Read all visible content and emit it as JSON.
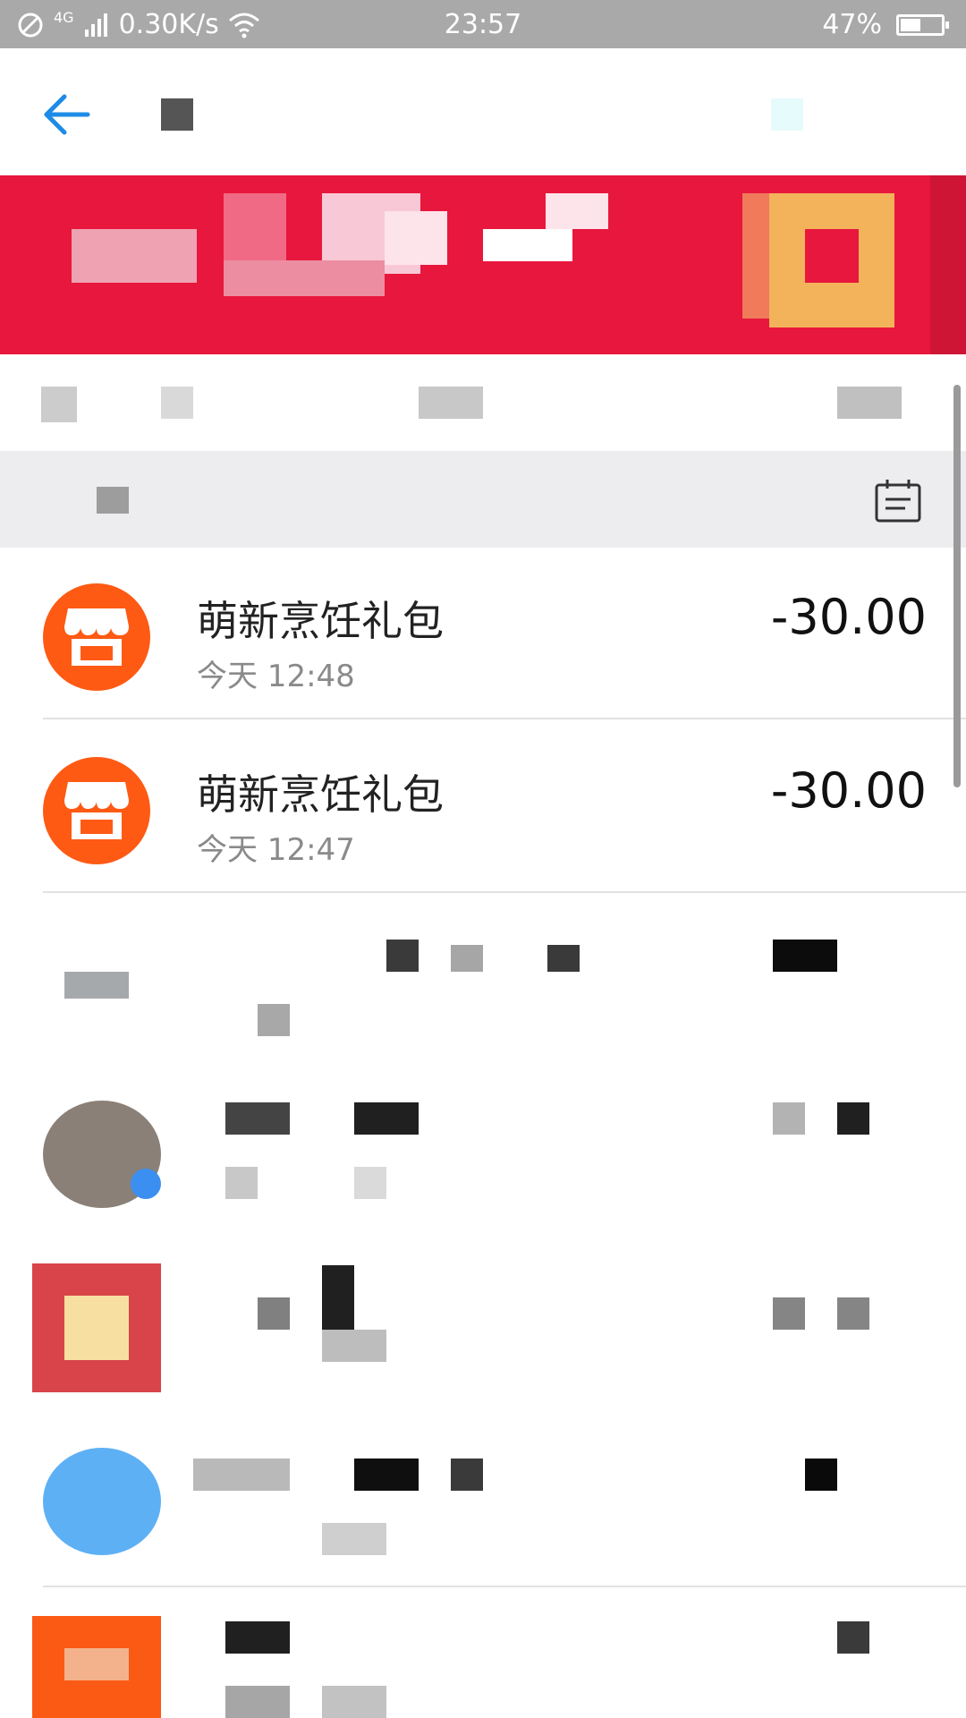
{
  "status_bar": {
    "network": "4G",
    "speed": "0.30K/s",
    "time": "23:57",
    "battery": "47%",
    "battery_level": 0.47
  },
  "header": {
    "back_icon": "back-arrow-icon"
  },
  "month_bar": {
    "calendar_icon": "calendar-icon"
  },
  "transactions": [
    {
      "name": "萌新烹饪礼包",
      "time": "今天  12:48",
      "amount": "-30.00",
      "icon": "shop-icon"
    },
    {
      "name": "萌新烹饪礼包",
      "time": "今天  12:47",
      "amount": "-30.00",
      "icon": "shop-icon"
    }
  ],
  "colors": {
    "status_bar": "#a9a9a9",
    "banner": "#e8173d",
    "shop_icon_bg": "#fe5a14",
    "back_arrow": "#1e8ce6"
  }
}
